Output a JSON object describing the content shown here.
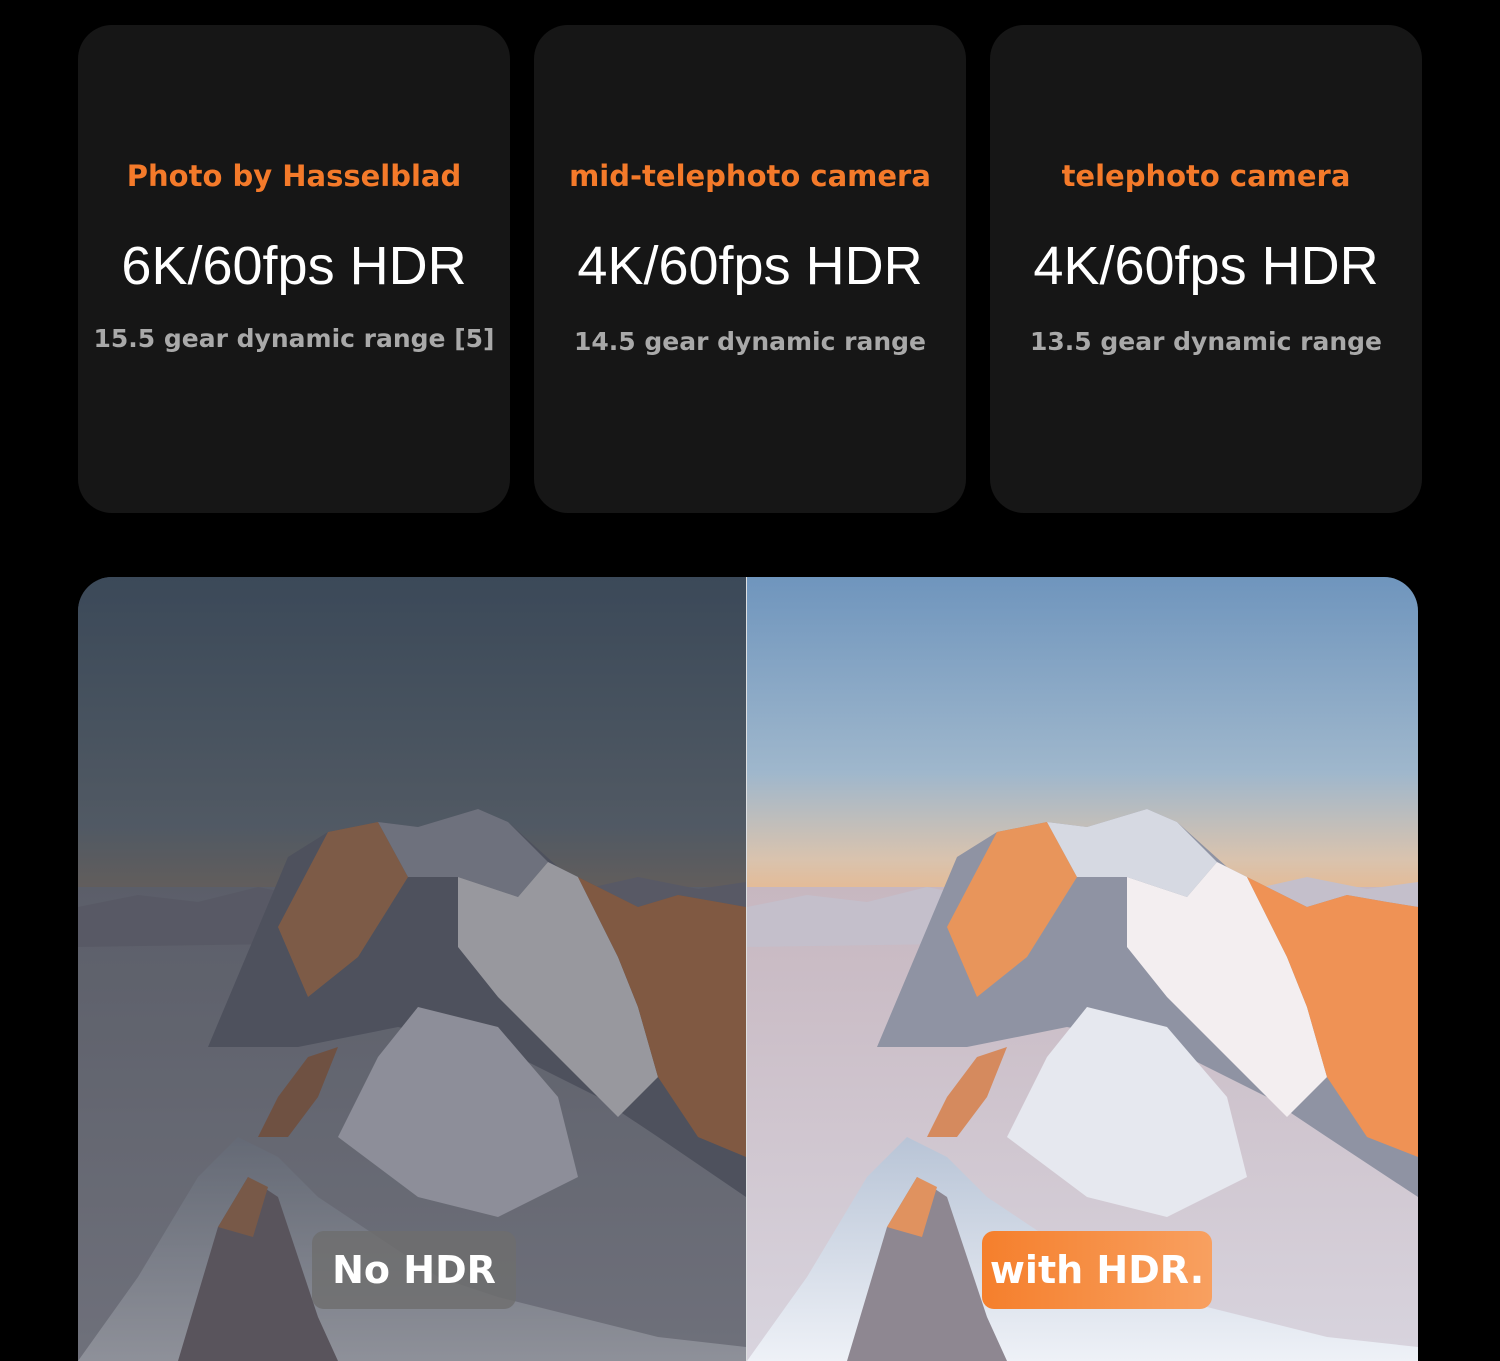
{
  "cards": [
    {
      "label": "Photo by Hasselblad",
      "spec": "6K/60fps HDR",
      "range": "15.5 gear dynamic range [5]"
    },
    {
      "label": "mid-telephoto camera",
      "spec": "4K/60fps HDR",
      "range": "14.5 gear dynamic range"
    },
    {
      "label": "telephoto camera",
      "spec": "4K/60fps HDR",
      "range": "13.5 gear dynamic range"
    }
  ],
  "comparison": {
    "left_badge": "No HDR",
    "right_badge": "with HDR."
  },
  "colors": {
    "page_background": "#000000",
    "card_background": "#161616",
    "accent_orange": "#f47a2a",
    "spec_text": "#ffffff",
    "range_text": "#a9a9a9",
    "badge_gray": "#6e6e6e",
    "badge_orange": "#f57f2c"
  }
}
